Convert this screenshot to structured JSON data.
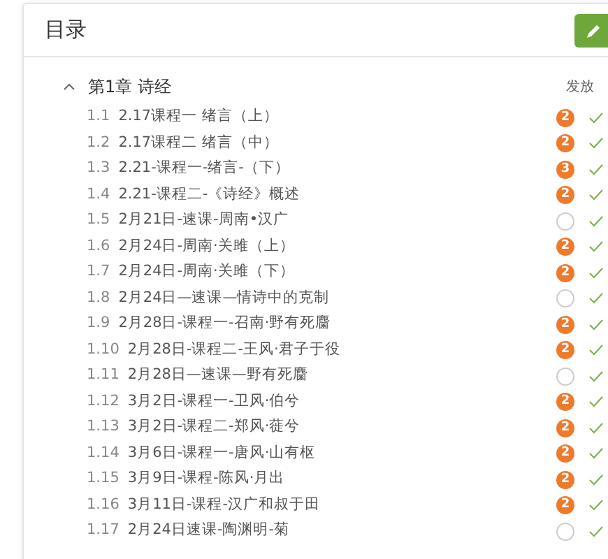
{
  "header": {
    "title": "目录"
  },
  "chapter": {
    "title": "第1章 诗经",
    "expanded": true,
    "column_label": "发放"
  },
  "lessons": [
    {
      "number": "1.1",
      "title": "2.17课程一 绪言（上）",
      "badge": "2",
      "checked": true
    },
    {
      "number": "1.2",
      "title": "2.17课程二 绪言（中）",
      "badge": "2",
      "checked": true
    },
    {
      "number": "1.3",
      "title": "2.21-课程一-绪言-（下）",
      "badge": "3",
      "checked": true
    },
    {
      "number": "1.4",
      "title": "2.21-课程二-《诗经》概述",
      "badge": "2",
      "checked": true
    },
    {
      "number": "1.5",
      "title": "2月21日-速课-周南•汉广",
      "checked": true
    },
    {
      "number": "1.6",
      "title": "2月24日-周南·关雎（上）",
      "badge": "2",
      "checked": true
    },
    {
      "number": "1.7",
      "title": "2月24日-周南·关雎（下）",
      "badge": "2",
      "checked": true
    },
    {
      "number": "1.8",
      "title": "2月24日—速课—情诗中的克制",
      "checked": true
    },
    {
      "number": "1.9",
      "title": "2月28日-课程一-召南·野有死麕",
      "badge": "2",
      "checked": true
    },
    {
      "number": "1.10",
      "title": "2月28日-课程二-王风·君子于役",
      "badge": "2",
      "checked": true
    },
    {
      "number": "1.11",
      "title": "2月28日—速课—野有死麕",
      "checked": true
    },
    {
      "number": "1.12",
      "title": "3月2日-课程一-卫风·伯兮",
      "badge": "2",
      "checked": true
    },
    {
      "number": "1.13",
      "title": "3月2日-课程二-郑风·蓰兮",
      "badge": "2",
      "checked": true
    },
    {
      "number": "1.14",
      "title": "3月6日-课程一-唐风·山有枢",
      "badge": "2",
      "checked": true
    },
    {
      "number": "1.15",
      "title": "3月9日-课程-陈风·月出",
      "badge": "2",
      "checked": true
    },
    {
      "number": "1.16",
      "title": "3月11日-课程-汉广和叔于田",
      "badge": "2",
      "checked": true
    },
    {
      "number": "1.17",
      "title": "2月24日速课-陶渊明-菊",
      "checked": true
    }
  ]
}
